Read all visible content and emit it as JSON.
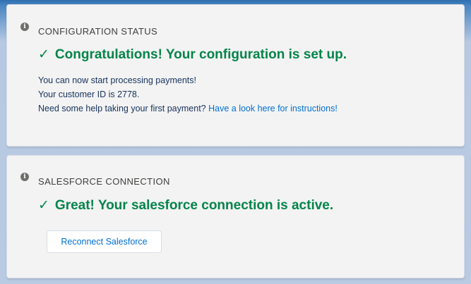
{
  "config_card": {
    "title": "CONFIGURATION STATUS",
    "info_icon": "info-icon",
    "check_mark": "✓",
    "headline": "Congratulations! Your configuration is set up.",
    "line1": "You can now start processing payments!",
    "line2": "Your customer ID is 2778.",
    "line3_text": "Need some help taking your first payment?",
    "line3_link": "Have a look here for instructions!"
  },
  "sf_card": {
    "title": "SALESFORCE CONNECTION",
    "info_icon": "info-icon",
    "check_mark": "✓",
    "headline": "Great! Your salesforce connection is active.",
    "button_label": "Reconnect Salesforce"
  },
  "colors": {
    "success_green": "#04844b",
    "link_blue": "#0070d2",
    "card_bg": "#f3f3f3"
  }
}
